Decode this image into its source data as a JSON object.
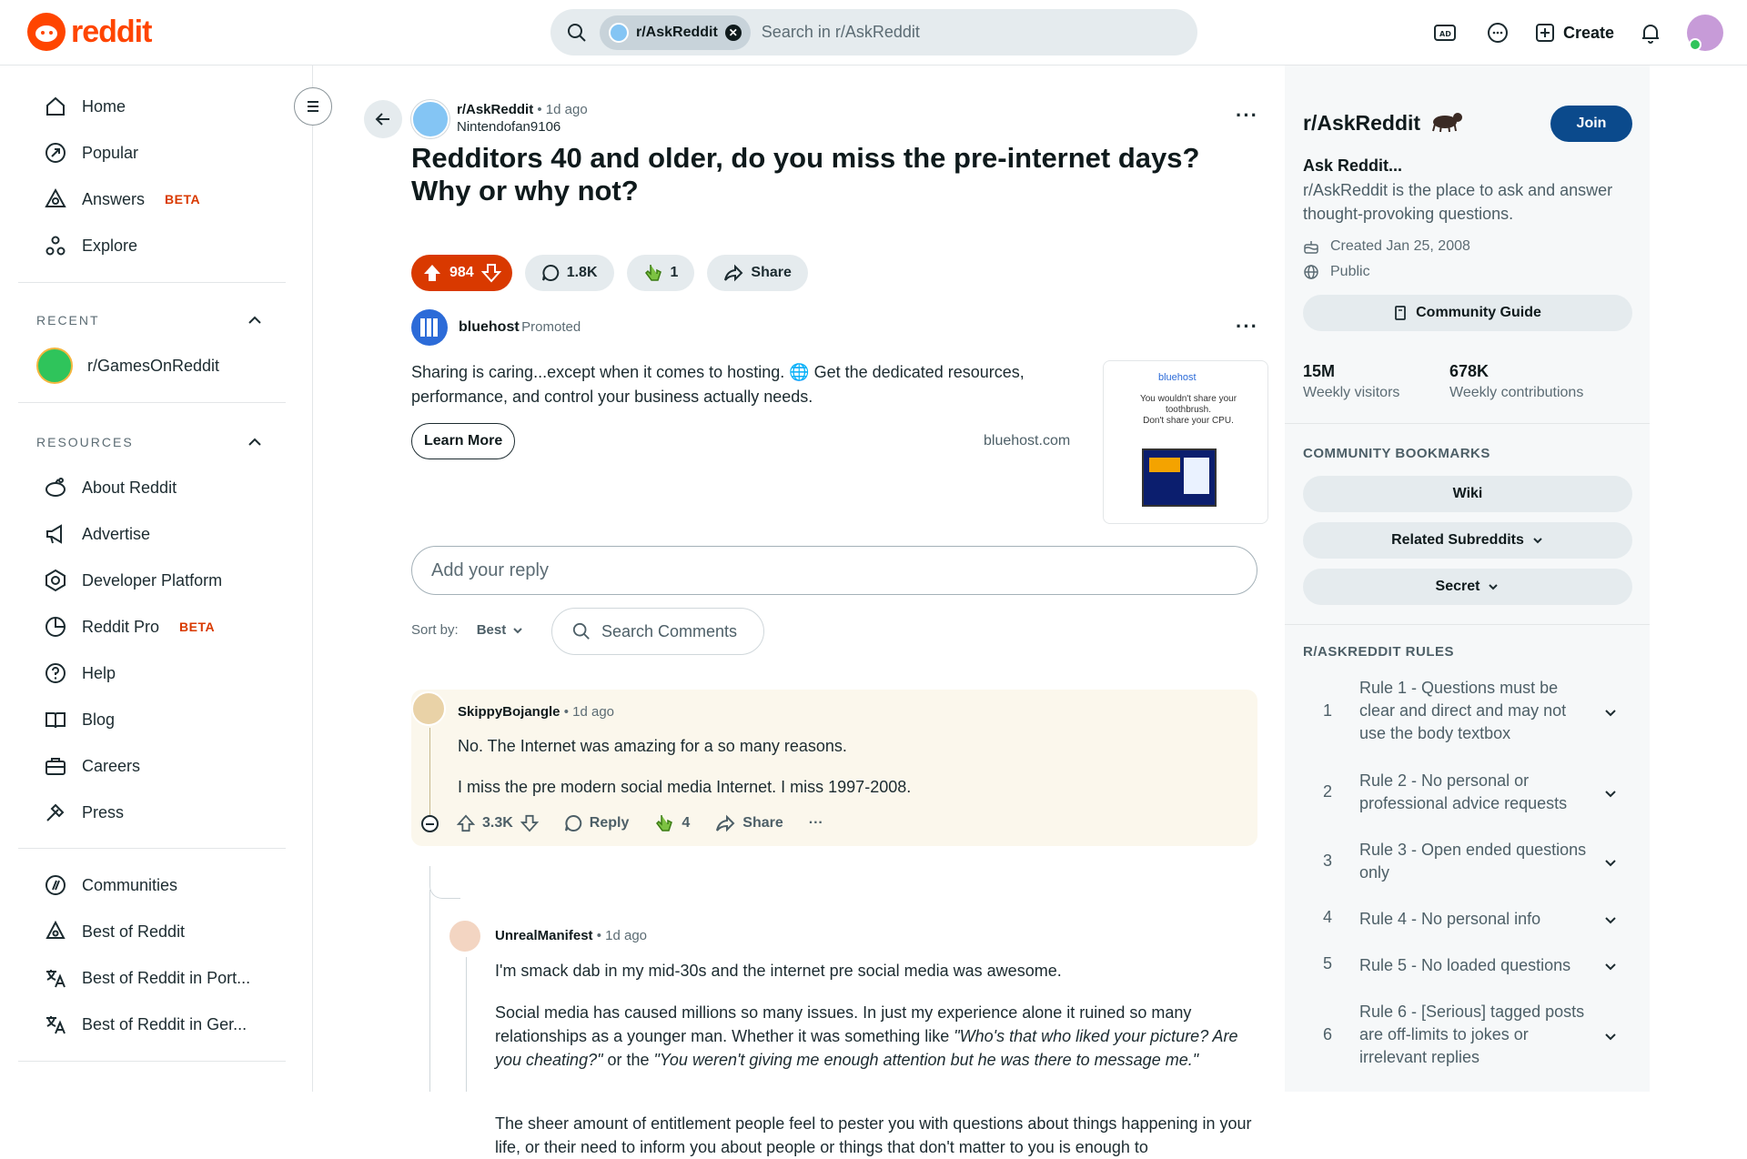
{
  "brand": {
    "logo_text": "reddit",
    "accent": "#ff4500"
  },
  "topbar": {
    "search_chip": "r/AskReddit",
    "search_placeholder": "Search in r/AskReddit",
    "create_label": "Create",
    "icons": [
      "advertise-icon",
      "chat-icon",
      "create-plus-icon",
      "notification-bell-icon",
      "user-avatar"
    ]
  },
  "sidebar": {
    "main": [
      {
        "label": "Home",
        "icon": "home-icon"
      },
      {
        "label": "Popular",
        "icon": "popular-icon"
      },
      {
        "label": "Answers",
        "icon": "answers-icon",
        "badge": "BETA"
      },
      {
        "label": "Explore",
        "icon": "explore-icon"
      }
    ],
    "recent_title": "RECENT",
    "recent": [
      {
        "label": "r/GamesOnReddit"
      }
    ],
    "resources_title": "RESOURCES",
    "resources": [
      {
        "label": "About Reddit",
        "icon": "reddit-alien-icon"
      },
      {
        "label": "Advertise",
        "icon": "megaphone-icon"
      },
      {
        "label": "Developer Platform",
        "icon": "developer-icon"
      },
      {
        "label": "Reddit Pro",
        "icon": "pro-icon",
        "badge": "BETA"
      },
      {
        "label": "Help",
        "icon": "help-icon"
      },
      {
        "label": "Blog",
        "icon": "blog-icon"
      },
      {
        "label": "Careers",
        "icon": "careers-icon"
      },
      {
        "label": "Press",
        "icon": "press-icon"
      }
    ],
    "bottom": [
      {
        "label": "Communities",
        "icon": "communities-icon"
      },
      {
        "label": "Best of Reddit",
        "icon": "best-of-icon"
      },
      {
        "label": "Best of Reddit in Port...",
        "icon": "translate-icon"
      },
      {
        "label": "Best of Reddit in Ger...",
        "icon": "translate-icon"
      }
    ]
  },
  "post": {
    "subreddit": "r/AskReddit",
    "time": "1d ago",
    "author": "Nintendofan9106",
    "title": "Redditors 40 and older, do you miss the pre-internet days? Why or why not?",
    "votes": "984",
    "comments": "1.8K",
    "awards": "1",
    "share_label": "Share"
  },
  "ad": {
    "advertiser": "bluehost",
    "promoted": "Promoted",
    "text": "Sharing is caring...except when it comes to hosting. 🌐 Get the dedicated resources, performance, and control your business actually needs.",
    "cta": "Learn More",
    "domain": "bluehost.com",
    "image_brand": "bluehost",
    "image_text_1": "You wouldn't share your toothbrush.",
    "image_text_2": "Don't share your CPU."
  },
  "reply_placeholder": "Add your reply",
  "sort": {
    "label": "Sort by:",
    "value": "Best"
  },
  "search_comments_placeholder": "Search Comments",
  "comments": [
    {
      "author": "SkippyBojangle",
      "time": "1d ago",
      "paragraphs": [
        "No. The Internet was amazing for a so many reasons.",
        "I miss the pre modern social media Internet. I miss 1997-2008."
      ],
      "votes": "3.3K",
      "reply_label": "Reply",
      "awards": "4",
      "share_label": "Share"
    },
    {
      "author": "UnrealManifest",
      "time": "1d ago",
      "p1": "I'm smack dab in my mid-30s and the internet pre social media was awesome.",
      "p2_a": "Social media has caused millions so many issues. In just my experience alone it ruined so many relationships as a younger man. Whether it was something like ",
      "p2_q1": "\"Who's that who liked your picture? Are you cheating?\"",
      "p2_b": " or the ",
      "p2_q2": "\"You weren't giving me enough attention but he was there to message me.\"",
      "p3": "The sheer amount of entitlement people feel to pester you with questions about things happening in your life, or their need to inform you about people or things that don't matter to you is enough to"
    }
  ],
  "community": {
    "name": "r/AskReddit",
    "join_label": "Join",
    "subtitle": "Ask Reddit...",
    "description": "r/AskReddit is the place to ask and answer thought-provoking questions.",
    "created": "Created Jan 25, 2008",
    "visibility": "Public",
    "guide_label": "Community Guide",
    "visitors": "15M",
    "visitors_label": "Weekly visitors",
    "contributions": "678K",
    "contributions_label": "Weekly contributions",
    "bookmarks_title": "COMMUNITY BOOKMARKS",
    "bookmarks": [
      "Wiki",
      "Related Subreddits",
      "Secret"
    ],
    "rules_title": "R/ASKREDDIT RULES",
    "rules": [
      {
        "n": "1",
        "text": "Rule 1 - Questions must be clear and direct and may not use the body textbox"
      },
      {
        "n": "2",
        "text": "Rule 2 - No personal or professional advice requests"
      },
      {
        "n": "3",
        "text": "Rule 3 - Open ended questions only"
      },
      {
        "n": "4",
        "text": "Rule 4 - No personal info"
      },
      {
        "n": "5",
        "text": "Rule 5 - No loaded questions"
      },
      {
        "n": "6",
        "text": "Rule 6 - [Serious] tagged posts are off-limits to jokes or irrelevant replies"
      }
    ]
  }
}
